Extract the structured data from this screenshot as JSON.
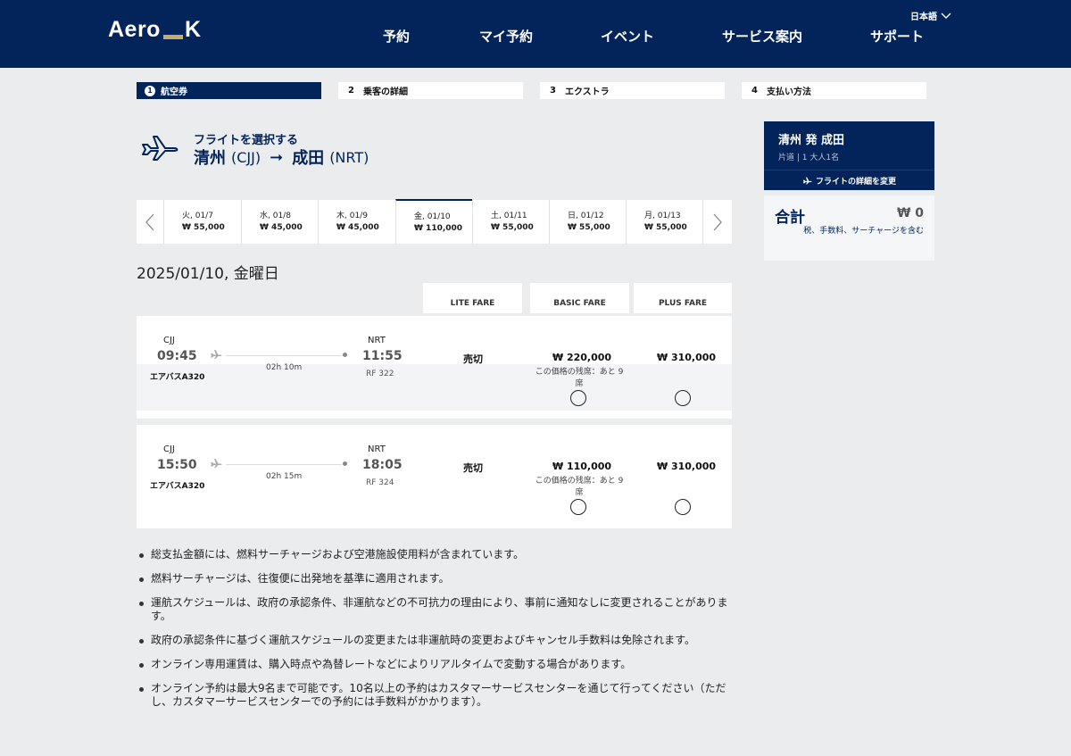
{
  "header": {
    "logo_left": "Aero",
    "logo_right": "K",
    "nav": [
      "予約",
      "マイ予約",
      "イベント",
      "サービス案内",
      "サポート"
    ],
    "language": "日本語"
  },
  "steps": [
    {
      "num": "1",
      "label": "航空券"
    },
    {
      "num": "2",
      "label": "乗客の詳細"
    },
    {
      "num": "3",
      "label": "エクストラ"
    },
    {
      "num": "4",
      "label": "支払い方法"
    }
  ],
  "flight_header": {
    "title": "フライトを選択する",
    "origin": "清州",
    "origin_code": "(CJJ)",
    "arrow": "➞",
    "destination": "成田",
    "destination_code": "(NRT)"
  },
  "dates": [
    {
      "label": "火, 01/7",
      "price": "₩ 55,000"
    },
    {
      "label": "水, 01/8",
      "price": "₩ 45,000"
    },
    {
      "label": "木, 01/9",
      "price": "₩ 45,000"
    },
    {
      "label": "金, 01/10",
      "price": "₩ 110,000"
    },
    {
      "label": "土, 01/11",
      "price": "₩ 55,000"
    },
    {
      "label": "日, 01/12",
      "price": "₩ 55,000"
    },
    {
      "label": "月, 01/13",
      "price": "₩ 55,000"
    }
  ],
  "selected_date": "2025/01/10, 金曜日",
  "fares": [
    "LITE FARE",
    "BASIC FARE",
    "PLUS FARE"
  ],
  "flights": [
    {
      "dep_code": "CJJ",
      "dep_time": "09:45",
      "arr_code": "NRT",
      "arr_time": "11:55",
      "aircraft": "エアバスA320",
      "duration": "02h 10m",
      "flight_no": "RF 322",
      "lite": "売切",
      "basic": "₩ 220,000",
      "basic_remaining_1": "この価格の残席：あと 9",
      "basic_remaining_2": "席",
      "plus": "₩ 310,000"
    },
    {
      "dep_code": "CJJ",
      "dep_time": "15:50",
      "arr_code": "NRT",
      "arr_time": "18:05",
      "aircraft": "エアバスA320",
      "duration": "02h 15m",
      "flight_no": "RF 324",
      "lite": "売切",
      "basic": "₩ 110,000",
      "basic_remaining_1": "この価格の残席：あと 9",
      "basic_remaining_2": "席",
      "plus": "₩ 310,000"
    }
  ],
  "notes": [
    "総支払金額には、燃料サーチャージおよび空港施設使用料が含まれています。",
    "燃料サーチャージは、往復便に出発地を基準に適用されます。",
    "運航スケジュールは、政府の承認条件、非運航などの不可抗力の理由により、事前に通知なしに変更されることがあります。",
    "政府の承認条件に基づく運航スケジュールの変更または非運航時の変更およびキャンセル手数料は免除されます。",
    "オンライン専用運賃は、購入時点や為替レートなどによりリアルタイムで変動する場合があります。",
    "オンライン予約は最大9名まで可能です。10名以上の予約はカスタマーサービスセンターを通じて行ってください（ただし、カスタマーサービスセンターでの予約には手数料がかかります）。"
  ],
  "summary": {
    "route": "清州 発 成田",
    "meta": "片道 | 1 大人1名",
    "change_button": "フライトの詳細を変更",
    "total_label": "合計",
    "total_value": "₩ 0",
    "total_note": "税、手数料、サーチャージを含む"
  },
  "colors": {
    "navy": "#02245b",
    "gold": "#c9a86a",
    "background": "#ebecee"
  }
}
